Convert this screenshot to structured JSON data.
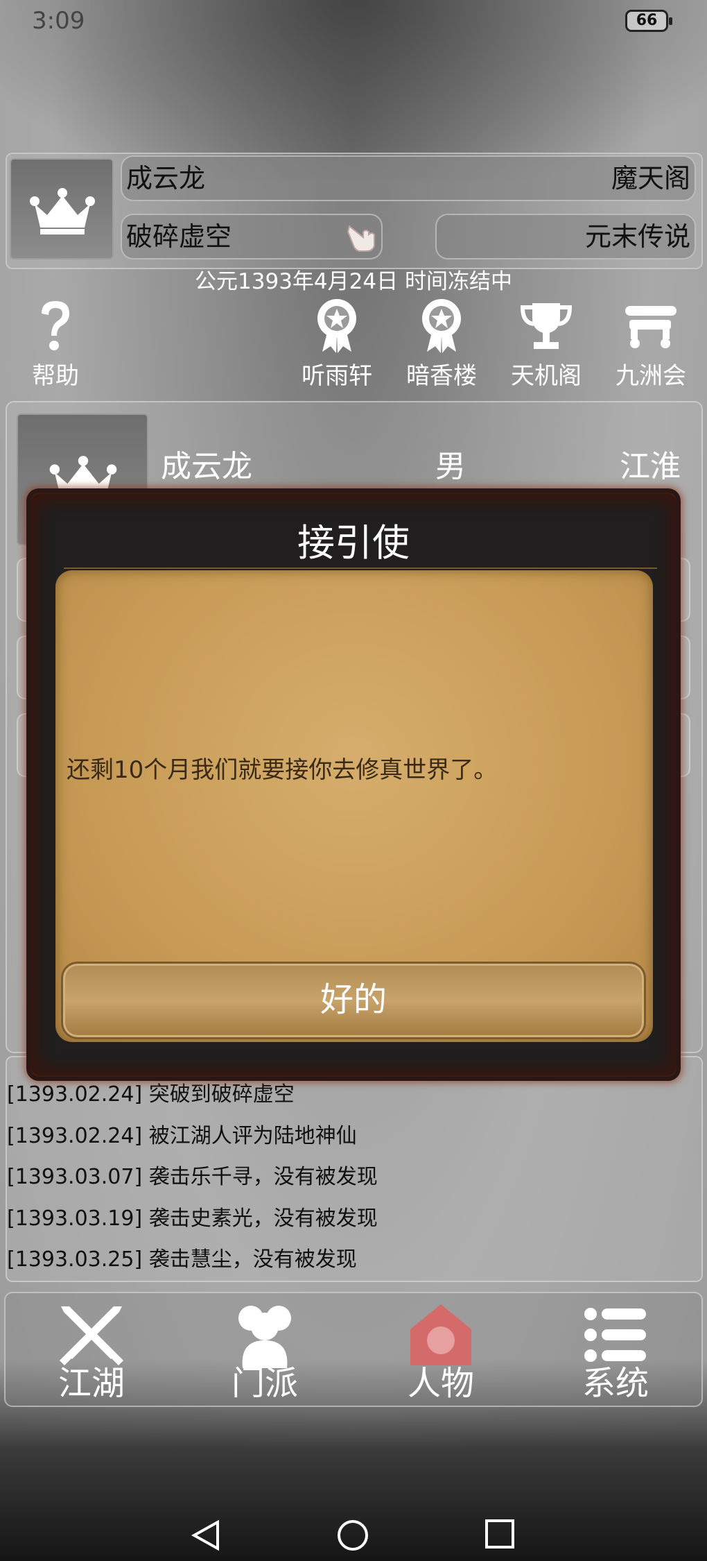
{
  "status_bar": {
    "time": "3:09",
    "battery": "66"
  },
  "header": {
    "player_name": "成云龙",
    "faction": "魔天阁",
    "realm": "破碎虚空",
    "title": "元末传说",
    "date_status": "公元1393年4月24日 时间冻结中"
  },
  "menu": {
    "help": "帮助",
    "items": [
      "听雨轩",
      "暗香楼",
      "天机阁",
      "九洲会"
    ]
  },
  "character": {
    "name": "成云龙",
    "gender": "男",
    "region": "江淮"
  },
  "log": [
    "[1393.02.24] 突破到破碎虚空",
    "[1393.02.24] 被江湖人评为陆地神仙",
    "[1393.03.07] 袭击乐千寻，没有被发现",
    "[1393.03.19] 袭击史素光，没有被发现",
    "[1393.03.25] 袭击慧尘，没有被发现"
  ],
  "bottom_nav": {
    "jianghu": "江湖",
    "menpai": "门派",
    "renwu": "人物",
    "xitong": "系统"
  },
  "modal": {
    "title": "接引使",
    "message": "还剩10个月我们就要接你去修真世界了。",
    "ok_label": "好的"
  },
  "colors": {
    "accent_active": "#d46a6a",
    "parchment": "#c99d58",
    "frame": "#201e1e"
  }
}
